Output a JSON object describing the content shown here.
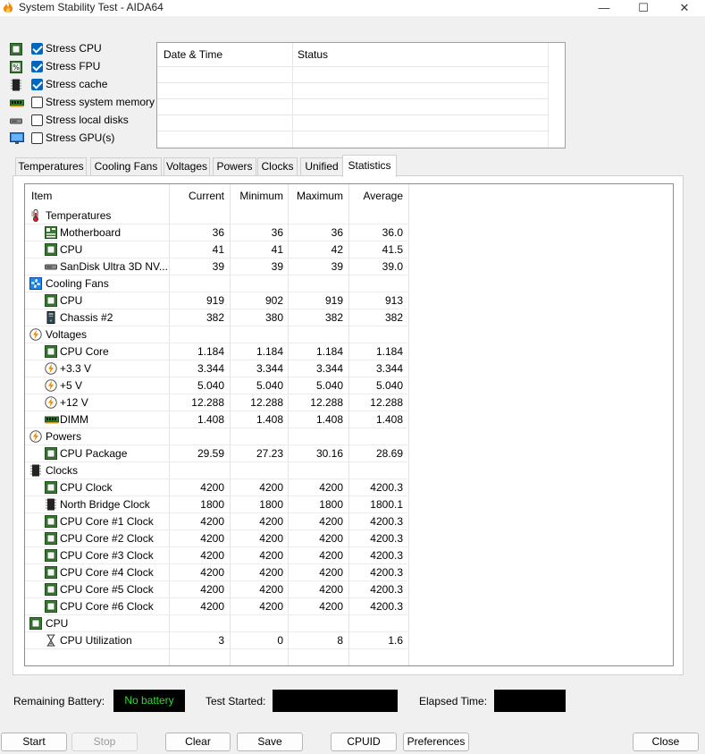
{
  "window": {
    "title": "System Stability Test - AIDA64",
    "minimize_glyph": "—",
    "maximize_glyph": "☐",
    "close_glyph": "✕"
  },
  "stress_options": [
    {
      "label": "Stress CPU",
      "checked": true,
      "icon": "cpu-chip-icon"
    },
    {
      "label": "Stress FPU",
      "checked": true,
      "icon": "fpu-icon"
    },
    {
      "label": "Stress cache",
      "checked": true,
      "icon": "cache-chip-icon"
    },
    {
      "label": "Stress system memory",
      "checked": false,
      "icon": "memory-module-icon"
    },
    {
      "label": "Stress local disks",
      "checked": false,
      "icon": "disk-icon"
    },
    {
      "label": "Stress GPU(s)",
      "checked": false,
      "icon": "monitor-icon"
    }
  ],
  "log": {
    "col_datetime": "Date & Time",
    "col_status": "Status"
  },
  "tabs": [
    {
      "label": "Temperatures",
      "active": false
    },
    {
      "label": "Cooling Fans",
      "active": false
    },
    {
      "label": "Voltages",
      "active": false
    },
    {
      "label": "Powers",
      "active": false
    },
    {
      "label": "Clocks",
      "active": false
    },
    {
      "label": "Unified",
      "active": false
    },
    {
      "label": "Statistics",
      "active": true
    }
  ],
  "table": {
    "headers": {
      "item": "Item",
      "current": "Current",
      "minimum": "Minimum",
      "maximum": "Maximum",
      "average": "Average"
    },
    "rows": [
      {
        "type": "group",
        "label": "Temperatures",
        "icon": "thermometer-icon"
      },
      {
        "type": "item",
        "label": "Motherboard",
        "icon": "motherboard-icon",
        "current": "36",
        "minimum": "36",
        "maximum": "36",
        "average": "36.0"
      },
      {
        "type": "item",
        "label": "CPU",
        "icon": "cpu-chip-icon",
        "current": "41",
        "minimum": "41",
        "maximum": "42",
        "average": "41.5"
      },
      {
        "type": "item",
        "label": "SanDisk Ultra 3D NV...",
        "icon": "disk-icon",
        "current": "39",
        "minimum": "39",
        "maximum": "39",
        "average": "39.0"
      },
      {
        "type": "group",
        "label": "Cooling Fans",
        "icon": "fan-icon"
      },
      {
        "type": "item",
        "label": "CPU",
        "icon": "cpu-chip-icon",
        "current": "919",
        "minimum": "902",
        "maximum": "919",
        "average": "913"
      },
      {
        "type": "item",
        "label": "Chassis #2",
        "icon": "chassis-icon",
        "current": "382",
        "minimum": "380",
        "maximum": "382",
        "average": "382"
      },
      {
        "type": "group",
        "label": "Voltages",
        "icon": "voltage-icon"
      },
      {
        "type": "item",
        "label": "CPU Core",
        "icon": "cpu-chip-icon",
        "current": "1.184",
        "minimum": "1.184",
        "maximum": "1.184",
        "average": "1.184"
      },
      {
        "type": "item",
        "label": "+3.3 V",
        "icon": "voltage-icon",
        "current": "3.344",
        "minimum": "3.344",
        "maximum": "3.344",
        "average": "3.344"
      },
      {
        "type": "item",
        "label": "+5 V",
        "icon": "voltage-icon",
        "current": "5.040",
        "minimum": "5.040",
        "maximum": "5.040",
        "average": "5.040"
      },
      {
        "type": "item",
        "label": "+12 V",
        "icon": "voltage-icon",
        "current": "12.288",
        "minimum": "12.288",
        "maximum": "12.288",
        "average": "12.288"
      },
      {
        "type": "item",
        "label": "DIMM",
        "icon": "memory-module-icon",
        "current": "1.408",
        "minimum": "1.408",
        "maximum": "1.408",
        "average": "1.408"
      },
      {
        "type": "group",
        "label": "Powers",
        "icon": "voltage-icon"
      },
      {
        "type": "item",
        "label": "CPU Package",
        "icon": "cpu-chip-icon",
        "current": "29.59",
        "minimum": "27.23",
        "maximum": "30.16",
        "average": "28.69"
      },
      {
        "type": "group",
        "label": "Clocks",
        "icon": "cache-chip-icon"
      },
      {
        "type": "item",
        "label": "CPU Clock",
        "icon": "cpu-chip-icon",
        "current": "4200",
        "minimum": "4200",
        "maximum": "4200",
        "average": "4200.3"
      },
      {
        "type": "item",
        "label": "North Bridge Clock",
        "icon": "cache-chip-icon",
        "current": "1800",
        "minimum": "1800",
        "maximum": "1800",
        "average": "1800.1"
      },
      {
        "type": "item",
        "label": "CPU Core #1 Clock",
        "icon": "cpu-chip-icon",
        "current": "4200",
        "minimum": "4200",
        "maximum": "4200",
        "average": "4200.3"
      },
      {
        "type": "item",
        "label": "CPU Core #2 Clock",
        "icon": "cpu-chip-icon",
        "current": "4200",
        "minimum": "4200",
        "maximum": "4200",
        "average": "4200.3"
      },
      {
        "type": "item",
        "label": "CPU Core #3 Clock",
        "icon": "cpu-chip-icon",
        "current": "4200",
        "minimum": "4200",
        "maximum": "4200",
        "average": "4200.3"
      },
      {
        "type": "item",
        "label": "CPU Core #4 Clock",
        "icon": "cpu-chip-icon",
        "current": "4200",
        "minimum": "4200",
        "maximum": "4200",
        "average": "4200.3"
      },
      {
        "type": "item",
        "label": "CPU Core #5 Clock",
        "icon": "cpu-chip-icon",
        "current": "4200",
        "minimum": "4200",
        "maximum": "4200",
        "average": "4200.3"
      },
      {
        "type": "item",
        "label": "CPU Core #6 Clock",
        "icon": "cpu-chip-icon",
        "current": "4200",
        "minimum": "4200",
        "maximum": "4200",
        "average": "4200.3"
      },
      {
        "type": "group",
        "label": "CPU",
        "icon": "cpu-chip-icon"
      },
      {
        "type": "item",
        "label": "CPU Utilization",
        "icon": "hourglass-icon",
        "current": "3",
        "minimum": "0",
        "maximum": "8",
        "average": "1.6"
      }
    ]
  },
  "status": {
    "battery_label": "Remaining Battery:",
    "battery_value": "No battery",
    "started_label": "Test Started:",
    "elapsed_label": "Elapsed Time:"
  },
  "buttons": {
    "start": "Start",
    "stop": "Stop",
    "clear": "Clear",
    "save": "Save",
    "cpuid": "CPUID",
    "preferences": "Preferences",
    "close": "Close"
  },
  "colors": {
    "checkbox_checked": "#0067c0",
    "battery_text": "#2de02d",
    "chip_green": "#3a7d32"
  }
}
